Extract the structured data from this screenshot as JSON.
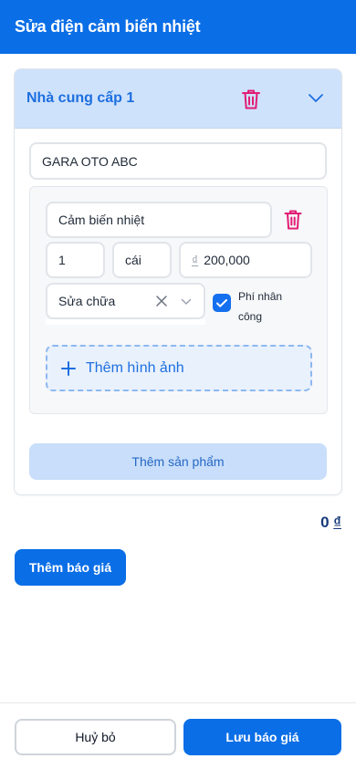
{
  "header": {
    "title": "Sửa điện cảm biến nhiệt"
  },
  "supplier": {
    "title": "Nhà cung cấp 1",
    "name_value": "GARA OTO ABC",
    "icons": {
      "delete": "trash-icon",
      "collapse": "chevron-down-icon"
    }
  },
  "product": {
    "name_value": "Cảm biến nhiệt",
    "quantity_value": "1",
    "unit_value": "cái",
    "currency_symbol": "₫",
    "price_value": "200,000",
    "type_value": "Sửa chữa",
    "labor_fee_checked": true,
    "labor_fee_label": "Phí nhân công",
    "add_image_label": "Thêm hình ảnh"
  },
  "add_product_label": "Thêm sản phẩm",
  "total": {
    "amount": "0",
    "currency": "₫"
  },
  "add_quote_label": "Thêm báo giá",
  "footer": {
    "cancel_label": "Huỷ bỏ",
    "save_label": "Lưu báo giá"
  },
  "colors": {
    "primary": "#0a6ee6",
    "danger": "#e11d74",
    "header_band": "#cfe2fb"
  }
}
